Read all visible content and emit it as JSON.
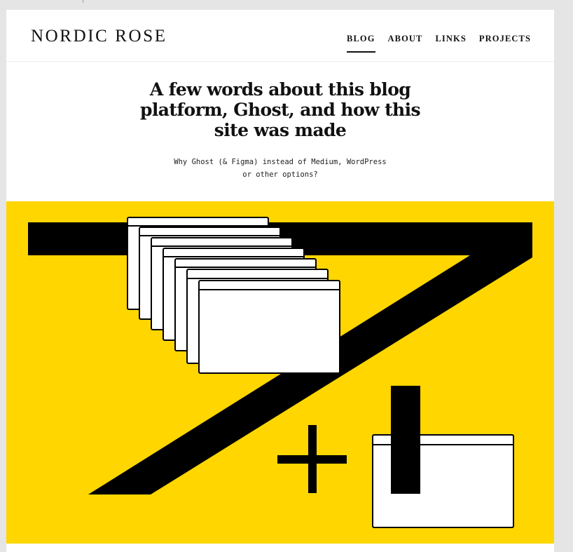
{
  "site": {
    "logo": "NORDIC ROSE",
    "nav": [
      {
        "label": "BLOG",
        "active": true
      },
      {
        "label": "ABOUT",
        "active": false
      },
      {
        "label": "LINKS",
        "active": false
      },
      {
        "label": "PROJECTS",
        "active": false
      }
    ]
  },
  "article": {
    "title_lines": [
      "A few words about this blog",
      "platform, Ghost, and how this",
      "site was made"
    ],
    "subtitle_lines": [
      "Why Ghost (& Figma) instead of Medium, WordPress",
      "or other options?"
    ]
  },
  "hero": {
    "background": "#FFD600",
    "ink": "#000000",
    "window_fill": "#ffffff",
    "symbols": [
      "seven-glyph",
      "browser-window-stack",
      "plus-sign",
      "browser-window",
      "vertical-bar"
    ]
  }
}
